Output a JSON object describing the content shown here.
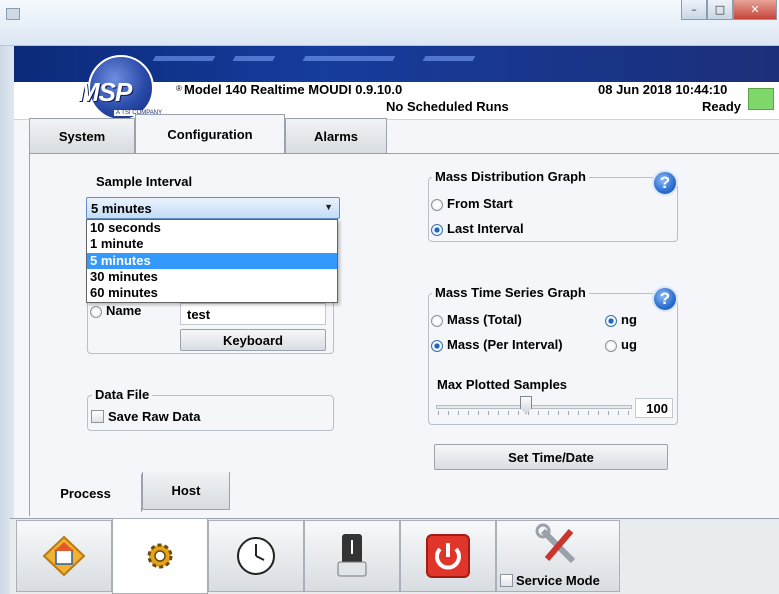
{
  "header": {
    "logo_text": "MSP",
    "logo_sub": "A TSI COMPANY",
    "registered": "®",
    "app_title": "Model 140 Realtime MOUDI 0.9.10.0",
    "schedule": "No Scheduled Runs",
    "datetime": "08 Jun 2018 10:44:10",
    "status": "Ready",
    "led_color": "#7fd66a"
  },
  "tabs": {
    "system": "System",
    "configuration": "Configuration",
    "alarms": "Alarms"
  },
  "sample_interval": {
    "label": "Sample Interval",
    "selected": "5 minutes",
    "options": [
      "10 seconds",
      "1 minute",
      "5 minutes",
      "30 minutes",
      "60 minutes"
    ]
  },
  "name_field": {
    "label": "Name",
    "value": "test",
    "keyboard": "Keyboard"
  },
  "data_file": {
    "title": "Data File",
    "save_raw": "Save Raw Data"
  },
  "mass_distribution": {
    "title": "Mass Distribution Graph",
    "from_start": "From Start",
    "last_interval": "Last Interval",
    "help": "?"
  },
  "mass_time_series": {
    "title": "Mass Time Series Graph",
    "mass_total": "Mass (Total)",
    "mass_per_interval": "Mass (Per Interval)",
    "ng": "ng",
    "ug": "ug",
    "max_label": "Max Plotted Samples",
    "max_value": "100",
    "help": "?"
  },
  "set_time": "Set Time/Date",
  "bottom_tabs": {
    "process": "Process",
    "host": "Host"
  },
  "toolbar": {
    "service_mode": "Service Mode"
  },
  "window_buttons": {
    "minimize": "–",
    "maximize": "□",
    "close": "✕"
  }
}
